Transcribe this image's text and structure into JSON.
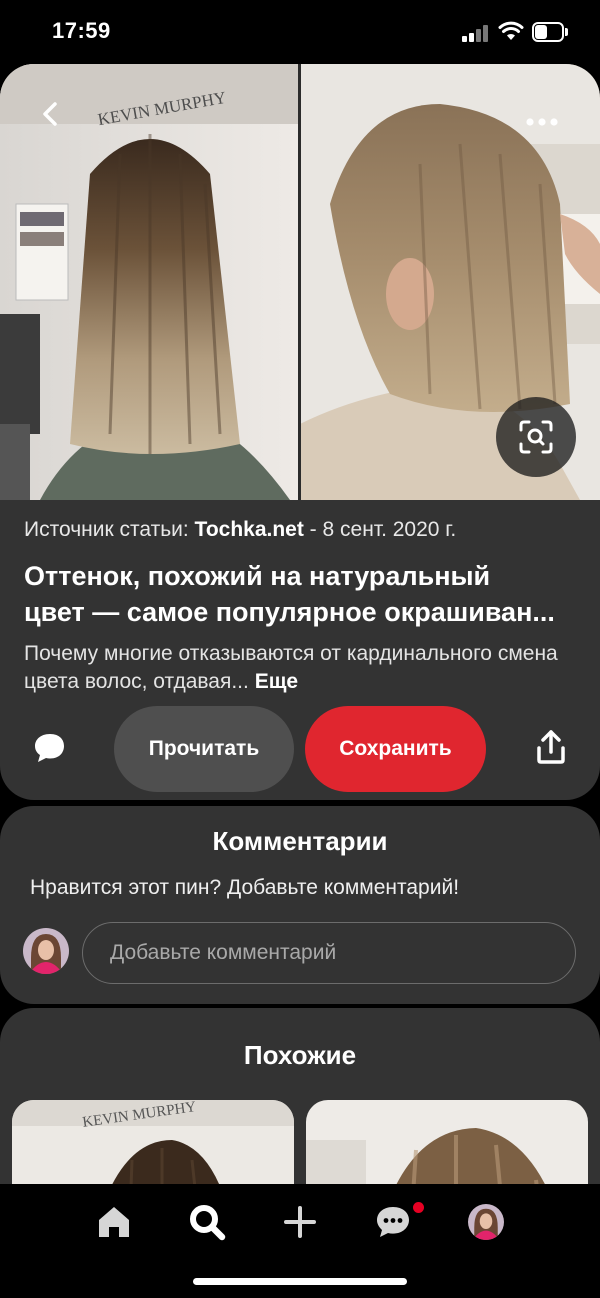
{
  "status_bar": {
    "time": "17:59"
  },
  "pin": {
    "source_prefix": "Источник статьи: ",
    "source_site": "Tochka.net",
    "source_date": " - 8 сент. 2020 г.",
    "title_line1": "Оттенок, похожий на натуральный",
    "title_line2": "цвет — самое популярное окрашиван...",
    "description": "Почему многие отказываются от кардинального смена цвета волос, отдавая... ",
    "more_label": "Еще",
    "read_label": "Прочитать",
    "save_label": "Сохранить",
    "image_sign_text": "KEVIN MURPHY"
  },
  "comments": {
    "title": "Комментарии",
    "prompt": "Нравится этот пин? Добавьте комментарий!",
    "input_placeholder": "Добавьте комментарий"
  },
  "similar": {
    "title": "Похожие"
  },
  "bottom_nav": {
    "items": [
      "home-icon",
      "search-icon",
      "plus-icon",
      "messages-icon",
      "profile-avatar"
    ],
    "notification_color": "#e60023"
  },
  "colors": {
    "save_button": "#e0262f",
    "card_background": "#333333",
    "read_button": "#4f4f4f"
  }
}
